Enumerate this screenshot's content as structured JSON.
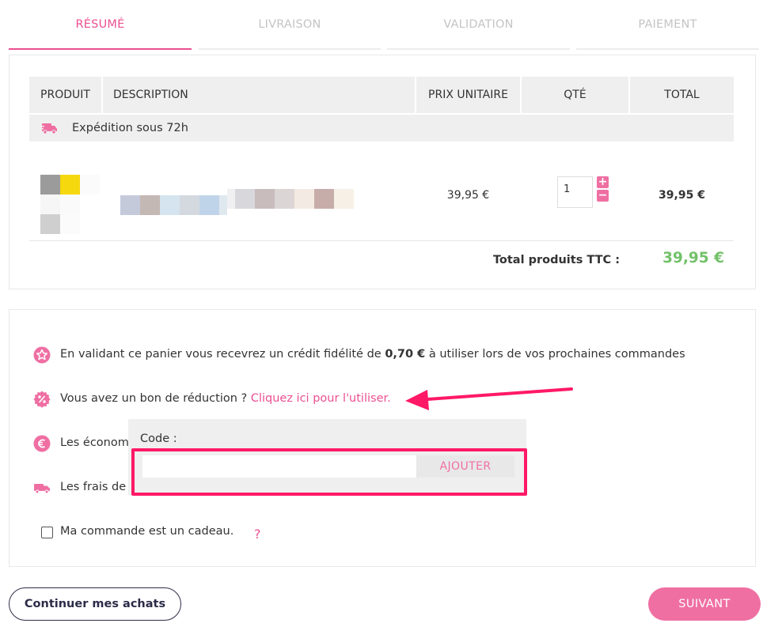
{
  "steps": [
    {
      "label": "RÉSUMÉ",
      "state": "active"
    },
    {
      "label": "LIVRAISON",
      "state": "inactive"
    },
    {
      "label": "VALIDATION",
      "state": "inactive"
    },
    {
      "label": "PAIEMENT",
      "state": "inactive"
    }
  ],
  "cart": {
    "headers": {
      "product": "PRODUIT",
      "description": "DESCRIPTION",
      "unit_price": "PRIX UNITAIRE",
      "qty": "QTÉ",
      "total": "TOTAL"
    },
    "shipping_note": "Expédition sous 72h",
    "item": {
      "unit_price": "39,95 €",
      "quantity": "1",
      "line_total": "39,95 €",
      "plus_symbol": "+",
      "minus_symbol": "−"
    },
    "total_label": "Total produits TTC :",
    "total_value": "39,95 €"
  },
  "info": {
    "loyalty_prefix": "En validant ce panier vous recevrez un crédit fidélité de",
    "loyalty_amount": "0,70 €",
    "loyalty_suffix": "à utiliser lors de vos prochaines commandes",
    "coupon_prefix": "Vous avez un bon de réduction ?",
    "coupon_link": "Cliquez ici pour l'utiliser.",
    "savings_text": "Les économ",
    "shipping_fees_text": "Les frais de",
    "gift_label": "Ma commande est un cadeau.",
    "gift_help": "?"
  },
  "coupon_popup": {
    "code_label": "Code :",
    "code_value": "",
    "add_button": "AJOUTER"
  },
  "buttons": {
    "continue": "Continuer mes achats",
    "next": "SUIVANT"
  },
  "colors": {
    "accent_pink": "#ec4f92",
    "button_pink": "#ef6fa3",
    "price_green": "#72c169",
    "annotation_red": "#ff1966"
  }
}
